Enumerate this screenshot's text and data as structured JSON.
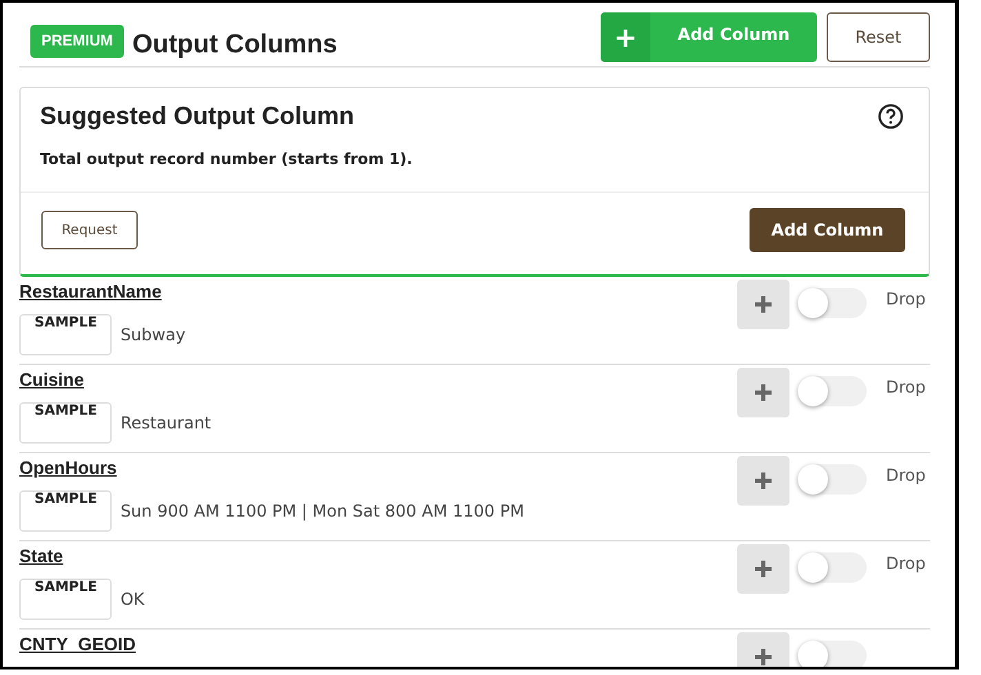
{
  "header": {
    "badge": "PREMIUM",
    "title": "Output Columns",
    "add_button": "+",
    "add_label": "Add Column",
    "reset_button": "Reset"
  },
  "suggested": {
    "title": "Suggested Output Column",
    "description": "Total output record number (starts from 1).",
    "request_button": "Request",
    "add_button": "Add Column"
  },
  "columns": [
    {
      "name": "RestaurantName",
      "sample_label": "SAMPLE",
      "sample": "Subway",
      "on": false,
      "drop_label": "Drop"
    },
    {
      "name": "Cuisine",
      "sample_label": "SAMPLE",
      "sample": "Restaurant",
      "on": false,
      "drop_label": "Drop"
    },
    {
      "name": "OpenHours",
      "sample_label": "SAMPLE",
      "sample": "Sun 900 AM 1100 PM | Mon Sat 800 AM 1100 PM",
      "on": false,
      "drop_label": "Drop"
    },
    {
      "name": "State",
      "sample_label": "SAMPLE",
      "sample": "OK",
      "on": false,
      "drop_label": "Drop"
    },
    {
      "name": "CNTY_GEOID",
      "on": false
    }
  ]
}
